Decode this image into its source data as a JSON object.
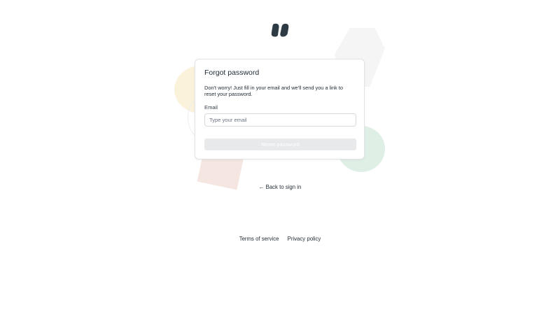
{
  "brand": {
    "logo_icon": "quote-marks-logo-icon",
    "logo_color": "#2f3b44"
  },
  "card": {
    "title": "Forgot password",
    "description": "Don't worry! Just fill in your email and we'll send you a link to reset your password.",
    "email_label": "Email",
    "email_placeholder": "Type your email",
    "email_value": "",
    "submit_label": "Reset password"
  },
  "back_link": {
    "arrow": "←",
    "label": "Back to sign in"
  },
  "footer": {
    "terms_label": "Terms of service",
    "privacy_label": "Privacy policy"
  },
  "colors": {
    "button_disabled_bg": "#e8e9ea",
    "shape_yellow": "#fbf2dc",
    "shape_green": "#dfefe6",
    "shape_pink": "#f6e6e2",
    "shape_gray": "#f5f5f5"
  }
}
